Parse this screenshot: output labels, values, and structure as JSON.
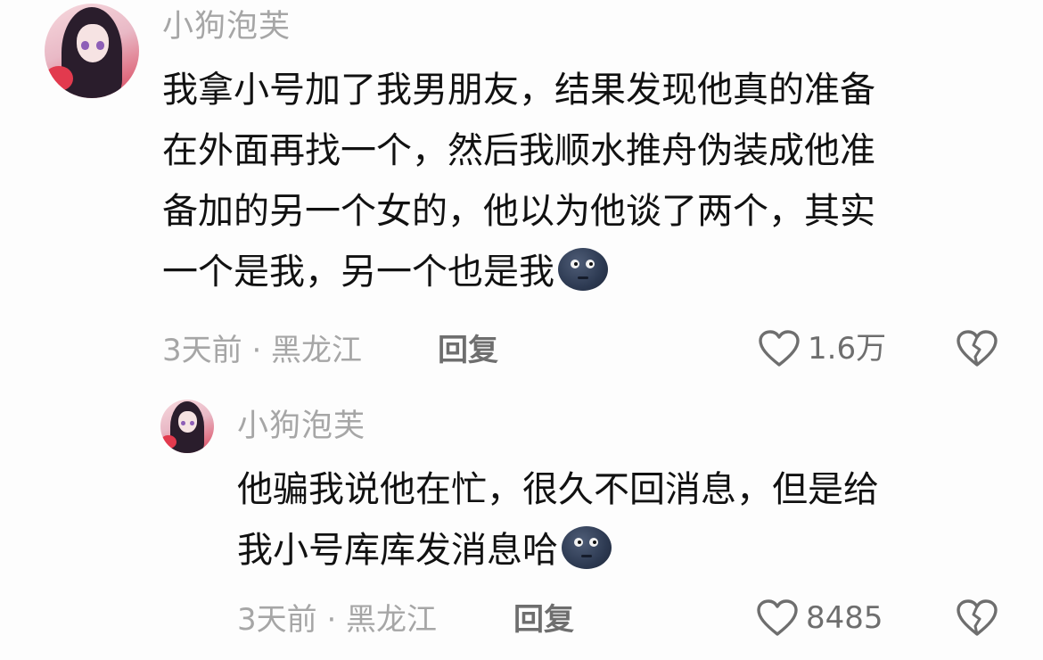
{
  "comments": [
    {
      "username": "小狗泡芙",
      "lines": [
        "我拿小号加了我男朋友，结果发现他真的准备",
        "在外面再找一个，然后我顺水推舟伪装成他准",
        "备加的另一个女的，他以为他谈了两个，其实",
        "一个是我，另一个也是我"
      ],
      "meta": "3天前 · 黑龙江",
      "reply_label": "回复",
      "like_count": "1.6万",
      "emoji": "new-moon-face"
    },
    {
      "username": "小狗泡芙",
      "lines": [
        "他骗我说他在忙，很久不回消息，但是给",
        "我小号库库发消息哈"
      ],
      "meta": "3天前 · 黑龙江",
      "reply_label": "回复",
      "like_count": "8485",
      "emoji": "new-moon-face"
    }
  ],
  "icons": {
    "like": "heart-outline-icon",
    "dislike": "broken-heart-icon"
  },
  "colors": {
    "text": "#111111",
    "muted": "#a6a6a6",
    "action": "#6e6e6e",
    "background": "#fdfdfd"
  }
}
